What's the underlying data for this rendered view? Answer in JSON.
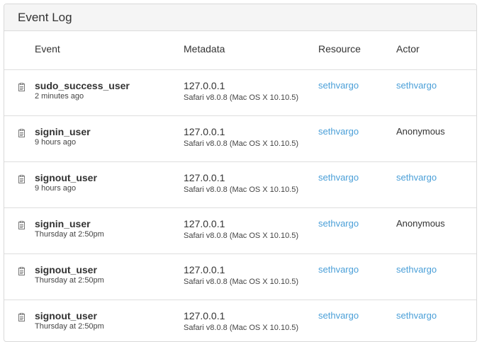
{
  "panel": {
    "title": "Event Log"
  },
  "columns": {
    "event": "Event",
    "metadata": "Metadata",
    "resource": "Resource",
    "actor": "Actor"
  },
  "colors": {
    "link": "#4a9fd8",
    "heading_bg": "#f5f5f5",
    "border": "#dedede"
  },
  "rows": [
    {
      "icon": "clipboard-icon",
      "event": "sudo_success_user",
      "time": "2 minutes ago",
      "ip": "127.0.0.1",
      "agent": "Safari v8.0.8 (Mac OS X 10.10.5)",
      "resource": "sethvargo",
      "actor": "sethvargo",
      "actor_is_link": true
    },
    {
      "icon": "clipboard-icon",
      "event": "signin_user",
      "time": "9 hours ago",
      "ip": "127.0.0.1",
      "agent": "Safari v8.0.8 (Mac OS X 10.10.5)",
      "resource": "sethvargo",
      "actor": "Anonymous",
      "actor_is_link": false
    },
    {
      "icon": "clipboard-icon",
      "event": "signout_user",
      "time": "9 hours ago",
      "ip": "127.0.0.1",
      "agent": "Safari v8.0.8 (Mac OS X 10.10.5)",
      "resource": "sethvargo",
      "actor": "sethvargo",
      "actor_is_link": true
    },
    {
      "icon": "clipboard-icon",
      "event": "signin_user",
      "time": "Thursday at 2:50pm",
      "ip": "127.0.0.1",
      "agent": "Safari v8.0.8 (Mac OS X 10.10.5)",
      "resource": "sethvargo",
      "actor": "Anonymous",
      "actor_is_link": false
    },
    {
      "icon": "clipboard-icon",
      "event": "signout_user",
      "time": "Thursday at 2:50pm",
      "ip": "127.0.0.1",
      "agent": "Safari v8.0.8 (Mac OS X 10.10.5)",
      "resource": "sethvargo",
      "actor": "sethvargo",
      "actor_is_link": true
    },
    {
      "icon": "clipboard-icon",
      "event": "signout_user",
      "time": "Thursday at 2:50pm",
      "ip": "127.0.0.1",
      "agent": "Safari v8.0.8 (Mac OS X 10.10.5)",
      "resource": "sethvargo",
      "actor": "sethvargo",
      "actor_is_link": true
    }
  ]
}
